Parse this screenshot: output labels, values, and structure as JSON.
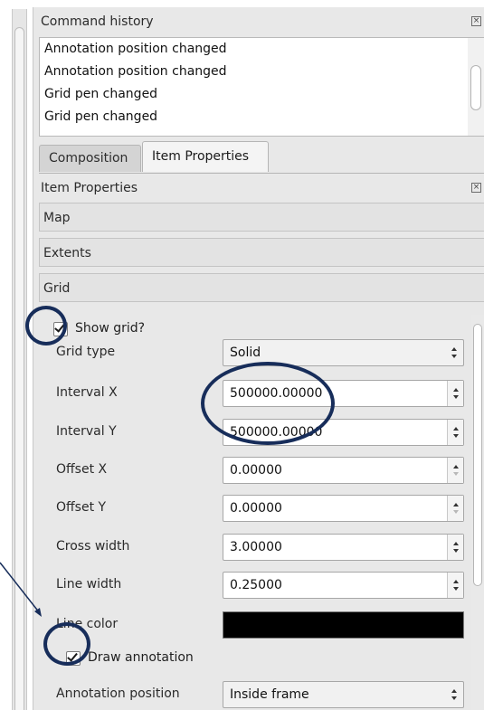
{
  "command_history": {
    "title": "Command history",
    "close_glyph": "×",
    "items": [
      "Annotation position changed",
      "Annotation position changed",
      "Grid pen changed",
      "Grid pen changed"
    ]
  },
  "tabs": [
    {
      "label": "Composition",
      "selected": false
    },
    {
      "label": "Item Properties",
      "selected": true
    }
  ],
  "item_properties": {
    "title": "Item Properties",
    "close_glyph": "×",
    "sections": [
      "Map",
      "Extents",
      "Grid"
    ]
  },
  "grid": {
    "show_grid": {
      "label": "Show grid?",
      "checked": true
    },
    "grid_type": {
      "label": "Grid type",
      "value": "Solid"
    },
    "interval_x": {
      "label": "Interval X",
      "value": "500000.00000"
    },
    "interval_y": {
      "label": "Interval Y",
      "value": "500000.00000"
    },
    "offset_x": {
      "label": "Offset X",
      "value": "0.00000"
    },
    "offset_y": {
      "label": "Offset Y",
      "value": "0.00000"
    },
    "cross_width": {
      "label": "Cross width",
      "value": "3.00000"
    },
    "line_width": {
      "label": "Line width",
      "value": "0.25000"
    },
    "line_color": {
      "label": "Line color",
      "value": "#000000"
    },
    "draw_annotation": {
      "label": "Draw annotation",
      "checked": true
    },
    "annotation_position": {
      "label": "Annotation position",
      "value": "Inside frame"
    }
  },
  "colors": {
    "annotation_ring": "#172d5a",
    "panel_bg": "#e8e8e8"
  }
}
